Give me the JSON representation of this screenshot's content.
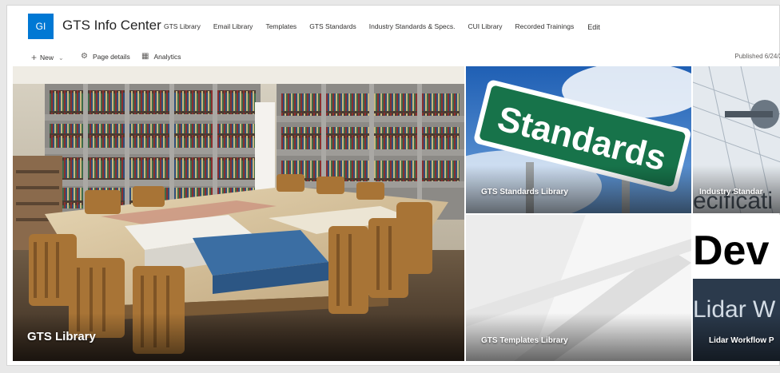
{
  "site": {
    "logo_initials": "GI",
    "title": "GTS Info Center"
  },
  "nav": {
    "items": [
      "GTS Library",
      "Email Library",
      "Templates",
      "GTS Standards",
      "Industry Standards & Specs.",
      "CUI Library",
      "Recorded Trainings"
    ],
    "edit_label": "Edit"
  },
  "commands": {
    "new_label": "New",
    "page_details_label": "Page details",
    "analytics_label": "Analytics",
    "published": "Published 6/24/2"
  },
  "hero": {
    "main": {
      "label": "GTS Library"
    },
    "standards": {
      "label": "GTS Standards Library",
      "sign_text": "Standards"
    },
    "industry": {
      "label": "Industry Standar",
      "overlay_text": "ecificati"
    },
    "templates": {
      "label": "GTS Templates Library"
    },
    "lidar": {
      "label": "Lidar Workflow P",
      "top_text": "Dev",
      "mid_text": "Lidar W"
    }
  },
  "icons": {
    "plus": "+",
    "chevron": "⌄",
    "gear": "⚙",
    "analytics": "▦"
  },
  "colors": {
    "brand": "#0078d4"
  }
}
